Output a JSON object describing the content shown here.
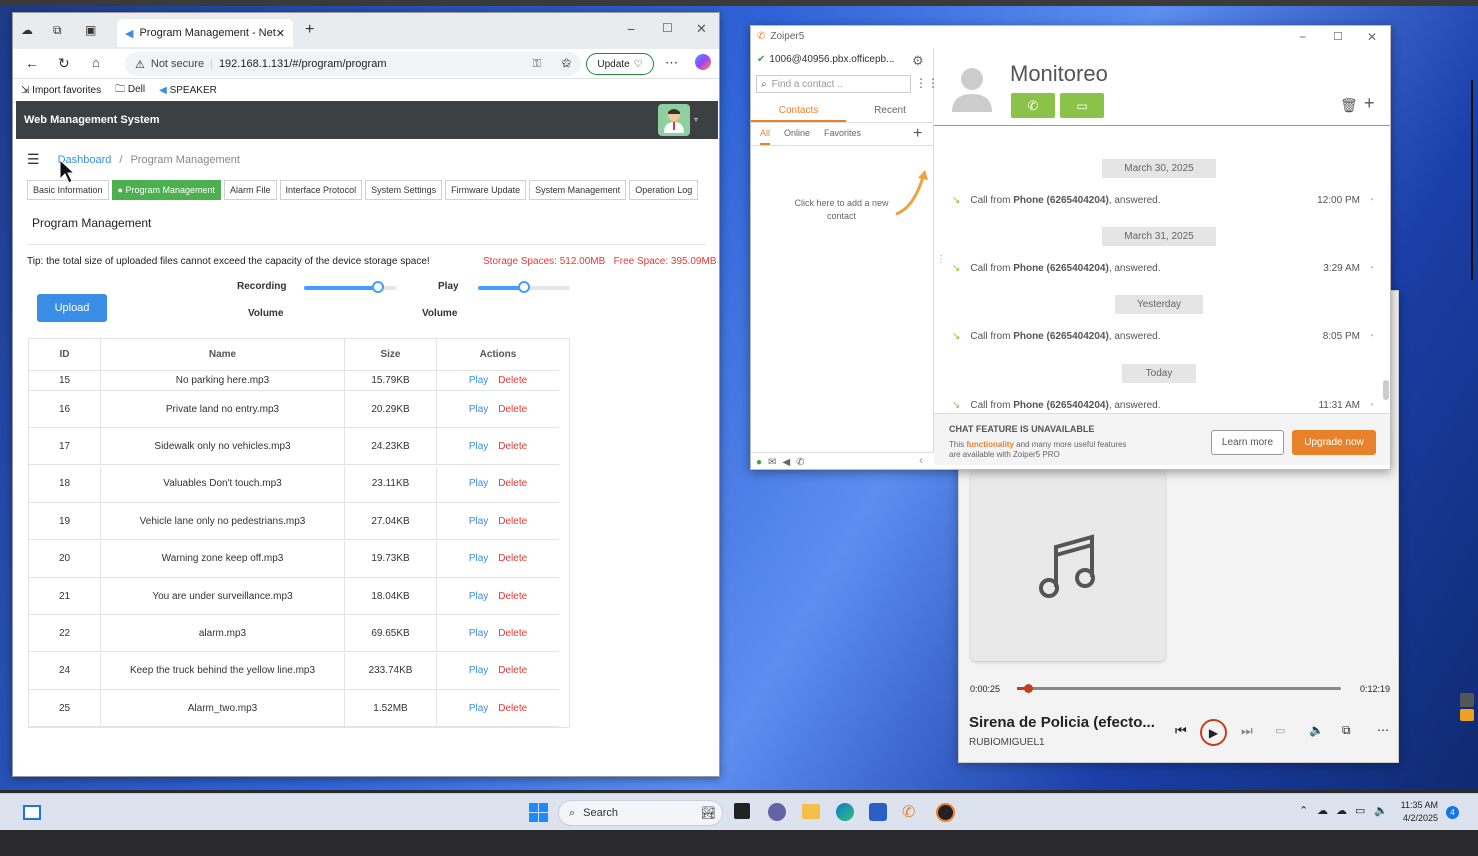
{
  "browser": {
    "tab_title": "Program Management - Network",
    "url_warning": "Not secure",
    "url": "192.168.1.131/#/program/program",
    "update_label": "Update",
    "favorites": [
      "Import favorites",
      "Dell",
      "SPEAKER"
    ]
  },
  "app": {
    "header_title": "Web Management System",
    "breadcrumb_home": "Dashboard",
    "breadcrumb_sep": "/",
    "breadcrumb_current": "Program Management",
    "tabs": [
      "Basic Information",
      "Program Management",
      "Alarm File",
      "Interface Protocol",
      "System Settings",
      "Firmware Update",
      "System Management",
      "Operation Log"
    ],
    "active_tab": "Program Management",
    "page_title": "Program Management",
    "tip": "Tip: the total size of uploaded files cannot exceed the capacity of the device storage space!",
    "storage": "Storage Spaces: 512.00MB",
    "free_space": "Free Space: 395.09MB",
    "upload_label": "Upload",
    "recording_label": "Recording",
    "play_label": "Play",
    "volume_label": "Volume",
    "recording_volume": 0.8,
    "play_volume": 0.5,
    "columns": [
      "ID",
      "Name",
      "Size",
      "Actions"
    ],
    "play_action": "Play",
    "delete_action": "Delete",
    "rows": [
      {
        "id": "15",
        "name": "No parking here.mp3",
        "size": "15.79KB"
      },
      {
        "id": "16",
        "name": "Private land no entry.mp3",
        "size": "20.29KB"
      },
      {
        "id": "17",
        "name": "Sidewalk only no vehicles.mp3",
        "size": "24.23KB"
      },
      {
        "id": "18",
        "name": "Valuables Don't touch.mp3",
        "size": "23.11KB"
      },
      {
        "id": "19",
        "name": "Vehicle lane only no pedestrians.mp3",
        "size": "27.04KB"
      },
      {
        "id": "20",
        "name": "Warning zone keep off.mp3",
        "size": "19.73KB"
      },
      {
        "id": "21",
        "name": "You are under surveillance.mp3",
        "size": "18.04KB"
      },
      {
        "id": "22",
        "name": "alarm.mp3",
        "size": "69.65KB"
      },
      {
        "id": "24",
        "name": "Keep the truck behind the yellow line.mp3",
        "size": "233.74KB"
      },
      {
        "id": "25",
        "name": "Alarm_two.mp3",
        "size": "1.52MB"
      }
    ]
  },
  "zoiper": {
    "title": "Zoiper5",
    "account": "1006@40956.pbx.officepb...",
    "search_placeholder": "Find a contact ..",
    "tab_contacts": "Contacts",
    "tab_recent": "Recent",
    "filter_all": "All",
    "filter_online": "Online",
    "filter_favorites": "Favorites",
    "add_contact_hint": "Click here to add a new contact",
    "contact_name": "Monitoreo",
    "history": [
      {
        "date": "March 30, 2025",
        "caller": "Phone (6265404204)",
        "time": "12:00 PM"
      },
      {
        "date": "March 31, 2025",
        "caller": "Phone (6265404204)",
        "time": "3:29 AM"
      },
      {
        "date": "Yesterday",
        "caller": "Phone (6265404204)",
        "time": "8:05 PM"
      },
      {
        "date": "Today",
        "caller": "Phone (6265404204)",
        "time": "11:31 AM"
      }
    ],
    "call_prefix": "Call from",
    "call_suffix": ", answered.",
    "chat_unavailable": "CHAT FEATURE IS UNAVAILABLE",
    "chat_text_1": "This",
    "chat_text_hl": "functionality",
    "chat_text_2": "and many more useful features",
    "chat_text_3": "are available with Zoiper5 PRO",
    "learn_more": "Learn more",
    "upgrade_now": "Upgrade now"
  },
  "player": {
    "elapsed": "0:00:25",
    "total": "0:12:19",
    "progress": 0.034,
    "track_title": "Sirena de Policia (efecto...",
    "artist": "RUBIOMIGUEL1"
  },
  "taskbar": {
    "search_label": "Search",
    "time": "11:35 AM",
    "date": "4/2/2025",
    "notifications": "4"
  },
  "colors": {
    "accent": "#3a8ee6",
    "active_tab": "#4caf50",
    "zoiper_orange": "#e8822a",
    "danger": "#e53935"
  }
}
